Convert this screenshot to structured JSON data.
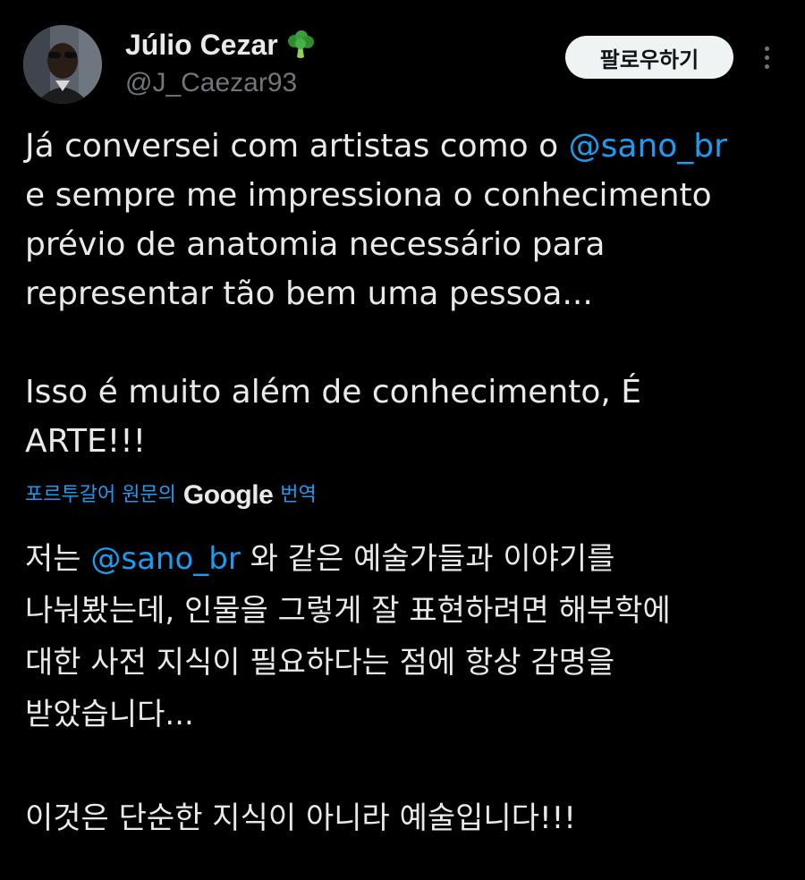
{
  "author": {
    "display_name": "Júlio Cezar",
    "handle": "@J_Caezar93",
    "badge_icon": "broccoli-icon"
  },
  "actions": {
    "follow_label": "팔로우하기",
    "more_icon": "more-vertical-icon"
  },
  "tweet": {
    "line1_before": "Já conversei com artistas como o ",
    "mention": "@sano_br",
    "line2": "e sempre me impressiona o conhecimento",
    "line3": "prévio de anatomia necessário para",
    "line4": "representar tão bem uma pessoa...",
    "line5": "Isso é muito além de conhecimento, É",
    "line6": "ARTE!!!"
  },
  "translation": {
    "prefix": "포르투갈어 원문의",
    "brand": "Google",
    "suffix": "번역",
    "line1_before": "저는 ",
    "mention": "@sano_br",
    "line1_after": " 와 같은 예술가들과 이야기를",
    "line2": "나눠봤는데, 인물을 그렇게 잘 표현하려면 해부학에",
    "line3": "대한 사전 지식이 필요하다는 점에 항상 감명을",
    "line4": "받았습니다...",
    "line5": "이것은 단순한 지식이 아니라 예술입니다!!!"
  },
  "colors": {
    "background": "#000000",
    "text": "#e7e9ea",
    "secondary": "#71767b",
    "link": "#1d9bf0",
    "follow_bg": "#eff3f4"
  }
}
